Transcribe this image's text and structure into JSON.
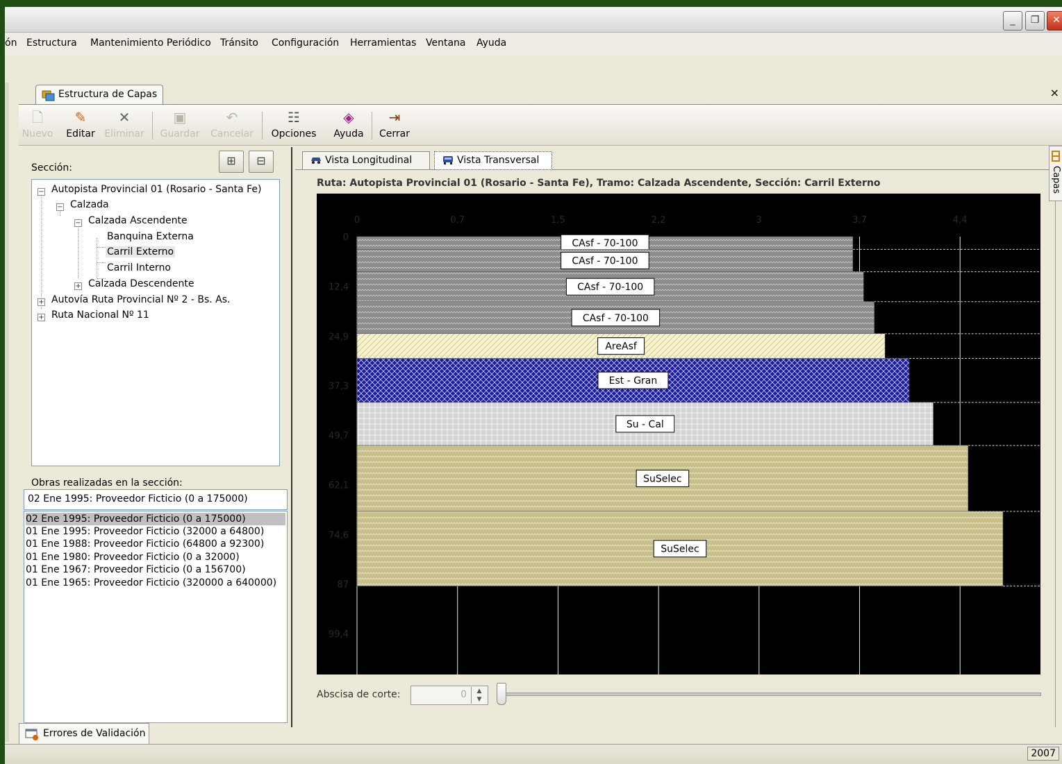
{
  "menu": [
    "ón",
    "Estructura",
    "Mantenimiento Periódico",
    "Tránsito",
    "Configuración",
    "Herramientas",
    "Ventana",
    "Ayuda"
  ],
  "window_buttons": {
    "minimize": "_",
    "restore": "❐",
    "close": "✕"
  },
  "document_tab": {
    "label": "Estructura de Capas",
    "close": "×"
  },
  "toolbar": {
    "nuevo": "Nuevo",
    "editar": "Editar",
    "eliminar": "Eliminar",
    "guardar": "Guardar",
    "cancelar": "Cancelar",
    "opciones": "Opciones",
    "ayuda": "Ayuda",
    "cerrar": "Cerrar"
  },
  "left": {
    "seccion_label": "Sección:",
    "tree": [
      "Autopista Provincial 01 (Rosario - Santa Fe)",
      "Calzada",
      "Calzada Ascendente",
      "Banquina Externa",
      "Carril Externo",
      "Carril Interno",
      "Calzada Descendente",
      "Autovía Ruta Provincial Nº 2 - Bs. As.",
      "Ruta Nacional Nº 11"
    ],
    "obras_label": "Obras realizadas en la sección:",
    "obras_selected": "02 Ene 1995: Proveedor Ficticio (0 a 175000)",
    "obras": [
      "02 Ene 1995: Proveedor Ficticio (0 a 175000)",
      "01 Ene 1995: Proveedor Ficticio (32000 a 64800)",
      "01 Ene 1988: Proveedor Ficticio (64800 a 92300)",
      "01 Ene 1980: Proveedor Ficticio (0 a 32000)",
      "01 Ene 1967: Proveedor Ficticio (0 a 156700)",
      "01 Ene 1965: Proveedor Ficticio (320000 a 640000)"
    ]
  },
  "right": {
    "tab_longitudinal": "Vista Longitudinal",
    "tab_transversal": "Vista Transversal",
    "ruta": "Ruta: Autopista Provincial 01 (Rosario - Santa Fe), Tramo: Calzada Ascendente, Sección: Carril Externo",
    "abscisa_label": "Abscisa de corte:",
    "abscisa_value": "0"
  },
  "chart_data": {
    "type": "bar",
    "x_ticks": [
      "0",
      "0,7",
      "1,5",
      "2,2",
      "3",
      "3,7",
      "4,4"
    ],
    "y_ticks": [
      "0",
      "12,4",
      "24,9",
      "37,3",
      "49,7",
      "62,1",
      "74,6",
      "87",
      "99,4"
    ],
    "xlim": [
      0,
      5.1
    ],
    "ylim": [
      0,
      99.4
    ],
    "layers": [
      {
        "label": "CAsf - 70-100",
        "top": 0,
        "bottom": 3.2,
        "width": 3.7,
        "color": "#8c8c8c",
        "pattern": "wave"
      },
      {
        "label": "CAsf - 70-100",
        "top": 3.2,
        "bottom": 8.8,
        "width": 3.7,
        "color": "#8c8c8c",
        "pattern": "wave"
      },
      {
        "label": "CAsf - 70-100",
        "top": 8.8,
        "bottom": 16.3,
        "width": 3.78,
        "color": "#8c8c8c",
        "pattern": "wave"
      },
      {
        "label": "CAsf - 70-100",
        "top": 16.3,
        "bottom": 24.3,
        "width": 3.86,
        "color": "#8c8c8c",
        "pattern": "wave"
      },
      {
        "label": "AreAsf",
        "top": 24.3,
        "bottom": 30.5,
        "width": 3.94,
        "color": "#f7f2cc",
        "pattern": "diag"
      },
      {
        "label": "Est - Gran",
        "top": 30.5,
        "bottom": 41.5,
        "width": 4.12,
        "color": "#1a1aa8",
        "pattern": "cross"
      },
      {
        "label": "Su - Cal",
        "top": 41.5,
        "bottom": 52.3,
        "width": 4.3,
        "color": "#d4d4d4",
        "pattern": "grid"
      },
      {
        "label": "SuSelec",
        "top": 52.3,
        "bottom": 68.8,
        "width": 4.56,
        "color": "#c8c08a",
        "pattern": "wave"
      },
      {
        "label": "SuSelec",
        "top": 68.8,
        "bottom": 87.5,
        "width": 4.82,
        "color": "#c8c08a",
        "pattern": "wave"
      }
    ]
  },
  "side_tab": "Capas",
  "bottom_tab": "Errores de Validación",
  "status": {
    "year": "2007"
  }
}
